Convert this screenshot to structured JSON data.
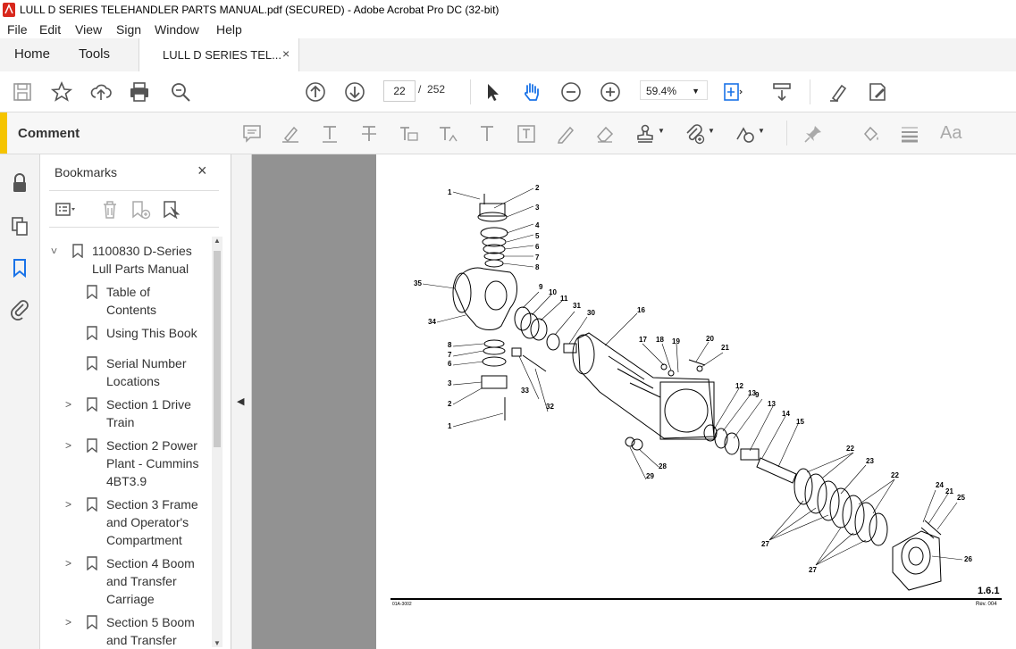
{
  "window": {
    "title": "LULL D SERIES TELEHANDLER PARTS MANUAL.pdf (SECURED) - Adobe Acrobat Pro DC (32-bit)"
  },
  "menu": [
    "File",
    "Edit",
    "View",
    "Sign",
    "Window",
    "Help"
  ],
  "tabs": {
    "home": "Home",
    "tools": "Tools",
    "document": "LULL D SERIES TEL...",
    "close": "×"
  },
  "toolbar": {
    "page_current": "22",
    "page_separator": "/",
    "page_total": "252",
    "zoom": "59.4%"
  },
  "comment_bar": {
    "label": "Comment"
  },
  "bookmarks": {
    "title": "Bookmarks",
    "close": "×",
    "items": [
      {
        "label": "1100830 D-Series\nLull Parts Manual",
        "expanded": true
      },
      {
        "label": "Table of\nContents"
      },
      {
        "label": "Using This Book"
      },
      {
        "label": "Serial Number\nLocations"
      },
      {
        "label": "Section 1 Drive\nTrain"
      },
      {
        "label": "Section 2 Power\nPlant - Cummins\n4BT3.9"
      },
      {
        "label": "Section 3 Frame\nand Operator's\nCompartment"
      },
      {
        "label": "Section 4 Boom\nand Transfer\nCarriage"
      },
      {
        "label": "Section 5 Boom\nand Transfer"
      }
    ]
  },
  "page": {
    "page_number": "1.6.1",
    "revision": "Rev. 004",
    "figure_id": "01A-3002",
    "callouts": [
      "1",
      "2",
      "3",
      "4",
      "5",
      "6",
      "7",
      "8",
      "9",
      "10",
      "11",
      "12",
      "13",
      "14",
      "15",
      "16",
      "17",
      "18",
      "19",
      "20",
      "21",
      "22",
      "23",
      "24",
      "25",
      "26",
      "27",
      "28",
      "29",
      "30",
      "31",
      "32",
      "33",
      "34",
      "35"
    ]
  },
  "colors": {
    "accent_yellow": "#f5c400",
    "doc_gray": "#929292",
    "icon_blue": "#1a73e8"
  }
}
